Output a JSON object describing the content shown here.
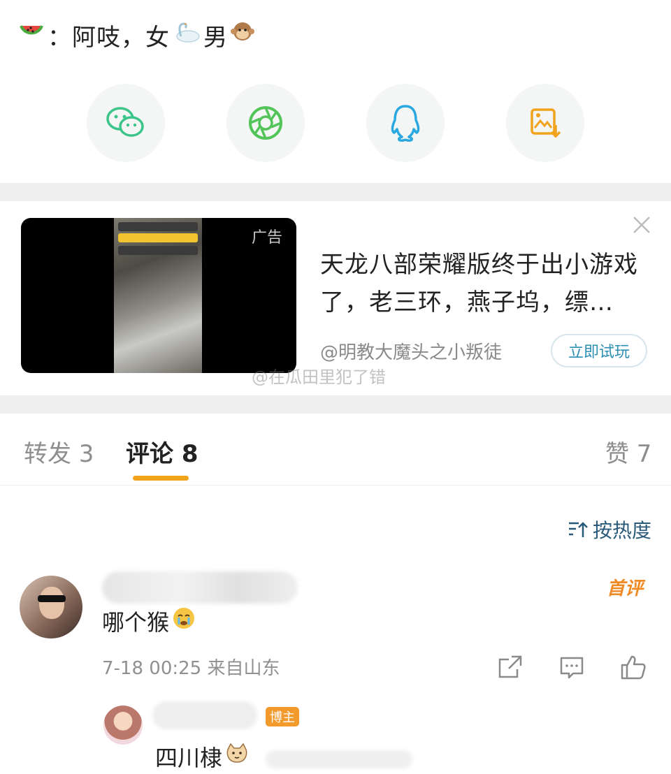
{
  "post": {
    "line_prefix": "：",
    "line_text": "阿吱，女",
    "line_text2": "男",
    "watermelon_icon": "watermelon-emoji",
    "swan_icon": "swan-emoji",
    "monkey_icon": "monkey-emoji"
  },
  "share": {
    "items": [
      {
        "icon": "wechat-icon",
        "color": "#3cc58a"
      },
      {
        "icon": "moments-icon",
        "color": "#52c45a"
      },
      {
        "icon": "qq-icon",
        "color": "#2aa8e0"
      },
      {
        "icon": "save-image-icon",
        "color": "#f2a31c"
      }
    ]
  },
  "ad": {
    "label": "广告",
    "title": "天龙八部荣耀版终于出小游戏了，老三环，燕子坞，缥…",
    "source": "@明教大魔头之小叛徒",
    "cta": "立即试玩",
    "watermark": "@在瓜田里犯了错"
  },
  "tabs": [
    {
      "label": "转发 3",
      "active": false
    },
    {
      "label": "评论 8",
      "active": true
    },
    {
      "label": "赞 7",
      "active": false
    }
  ],
  "sort": {
    "label": "按热度"
  },
  "comment": {
    "badge": "首评",
    "text": "哪个猴",
    "meta": "7-18 00:25 来自山东",
    "emoji": "crying-face-emoji"
  },
  "reply": {
    "badge": "博主",
    "text": "四川棣",
    "emoji": "cat-face-emoji"
  },
  "colors": {
    "accent": "#f2a31c",
    "link": "#2a8fb3",
    "muted": "#909090"
  }
}
